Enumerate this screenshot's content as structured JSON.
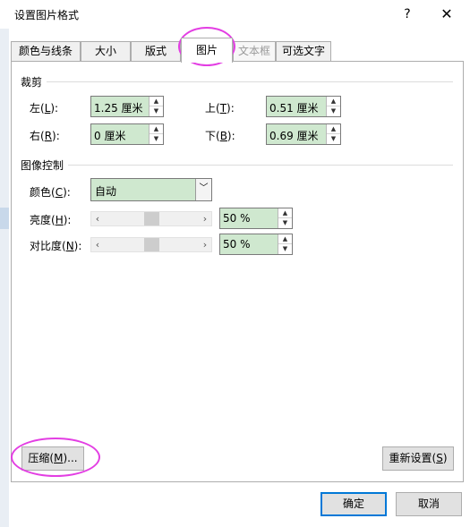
{
  "window": {
    "title": "设置图片格式",
    "help_glyph": "?",
    "close_glyph": "✕"
  },
  "tabs": [
    {
      "label": "颜色与线条",
      "state": "normal"
    },
    {
      "label": "大小",
      "state": "normal"
    },
    {
      "label": "版式",
      "state": "normal"
    },
    {
      "label": "图片",
      "state": "active"
    },
    {
      "label": "文本框",
      "state": "disabled"
    },
    {
      "label": "可选文字",
      "state": "normal"
    }
  ],
  "crop": {
    "section_label": "裁剪",
    "left": {
      "label": "左(",
      "key": "L",
      "suffix": "):",
      "value": "1.25 厘米"
    },
    "right": {
      "label": "右(",
      "key": "R",
      "suffix": "):",
      "value": "0 厘米"
    },
    "top": {
      "label": "上(",
      "key": "T",
      "suffix": "):",
      "value": "0.51 厘米"
    },
    "bottom": {
      "label": "下(",
      "key": "B",
      "suffix": "):",
      "value": "0.69 厘米"
    }
  },
  "image_control": {
    "section_label": "图像控制",
    "color": {
      "label": "颜色(",
      "key": "C",
      "suffix": "):",
      "value": "自动"
    },
    "brightness": {
      "label": "亮度(",
      "key": "H",
      "suffix": "):",
      "value": "50 %",
      "level": 0.5
    },
    "contrast": {
      "label": "对比度(",
      "key": "N",
      "suffix": "):",
      "value": "50 %",
      "level": 0.5
    }
  },
  "buttons": {
    "compress": {
      "label": "压缩(",
      "key": "M",
      "suffix": ")..."
    },
    "reset": {
      "label": "重新设置(",
      "key": "S",
      "suffix": ")"
    },
    "ok": "确定",
    "cancel": "取消"
  },
  "glyphs": {
    "spin_up": "▲",
    "spin_down": "▼",
    "dropdown": "﹀",
    "slider_left": "‹",
    "slider_right": "›"
  },
  "colors": {
    "highlight_ring": "#e33ee3",
    "input_fill": "#cfe8cf",
    "ok_border": "#0078d7"
  }
}
